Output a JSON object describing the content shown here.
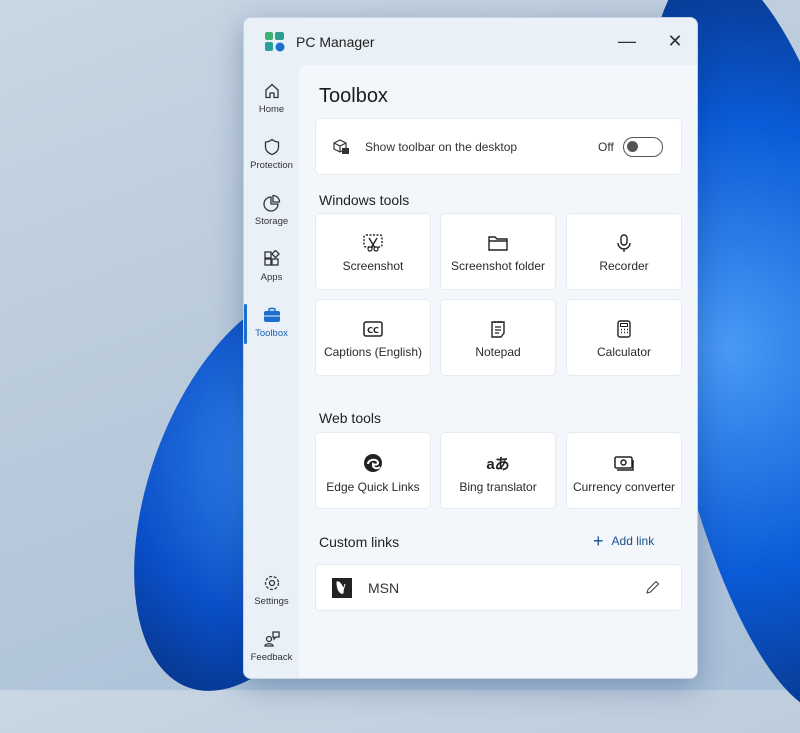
{
  "window": {
    "title": "PC Manager",
    "minimize": "—",
    "close": "✕"
  },
  "sidebar": {
    "items": [
      {
        "label": "Home",
        "icon": "home-icon"
      },
      {
        "label": "Protection",
        "icon": "shield-icon"
      },
      {
        "label": "Storage",
        "icon": "pie-chart-icon"
      },
      {
        "label": "Apps",
        "icon": "apps-icon"
      },
      {
        "label": "Toolbox",
        "icon": "toolbox-icon",
        "active": true
      }
    ],
    "bottom": [
      {
        "label": "Settings",
        "icon": "gear-icon"
      },
      {
        "label": "Feedback",
        "icon": "feedback-icon"
      }
    ]
  },
  "main": {
    "title": "Toolbox",
    "toolbar_setting": {
      "label": "Show toolbar on the desktop",
      "state": "Off"
    },
    "windows_tools": {
      "heading": "Windows tools",
      "items": [
        "Screenshot",
        "Screenshot folder",
        "Recorder",
        "Captions (English)",
        "Notepad",
        "Calculator"
      ]
    },
    "web_tools": {
      "heading": "Web tools",
      "items": [
        "Edge Quick Links",
        "Bing translator",
        "Currency converter"
      ],
      "translator_glyph": "aあ"
    },
    "custom_links": {
      "heading": "Custom links",
      "add_label": "Add link",
      "add_icon": "+",
      "links": [
        {
          "name": "MSN"
        }
      ]
    }
  },
  "colors": {
    "accent": "#1a6fd0"
  }
}
